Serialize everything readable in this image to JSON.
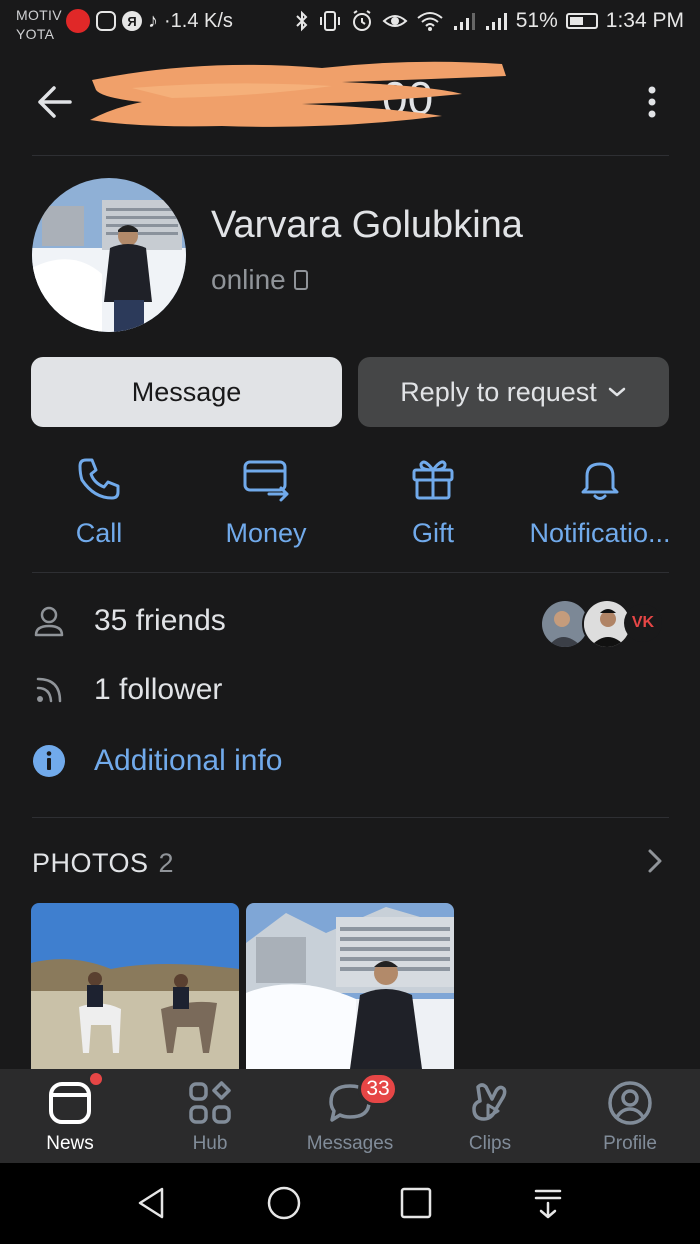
{
  "status_bar": {
    "carrier1": "MOTIV",
    "carrier2": "YOTA",
    "speed": "·1.4 K/s",
    "battery": "51%",
    "time": "1:34 PM"
  },
  "profile": {
    "name": "Varvara Golubkina",
    "status": "online"
  },
  "buttons": {
    "message": "Message",
    "reply": "Reply to request"
  },
  "actions": [
    {
      "label": "Call",
      "icon": "phone-icon"
    },
    {
      "label": "Money",
      "icon": "money-card-icon"
    },
    {
      "label": "Gift",
      "icon": "gift-icon"
    },
    {
      "label": "Notificatio...",
      "icon": "bell-icon"
    }
  ],
  "info": {
    "friends": "35 friends",
    "followers": "1 follower",
    "additional": "Additional info"
  },
  "photos": {
    "title": "PHOTOS",
    "count": "2"
  },
  "tabs": [
    {
      "label": "News",
      "icon": "news-icon",
      "active": true
    },
    {
      "label": "Hub",
      "icon": "hub-icon"
    },
    {
      "label": "Messages",
      "icon": "messages-icon",
      "badge": "33"
    },
    {
      "label": "Clips",
      "icon": "clips-icon"
    },
    {
      "label": "Profile",
      "icon": "profile-icon"
    }
  ],
  "colors": {
    "background": "#19191a",
    "accent": "#71aaeb",
    "badge": "#e64646",
    "redaction": "#f0a06a"
  }
}
